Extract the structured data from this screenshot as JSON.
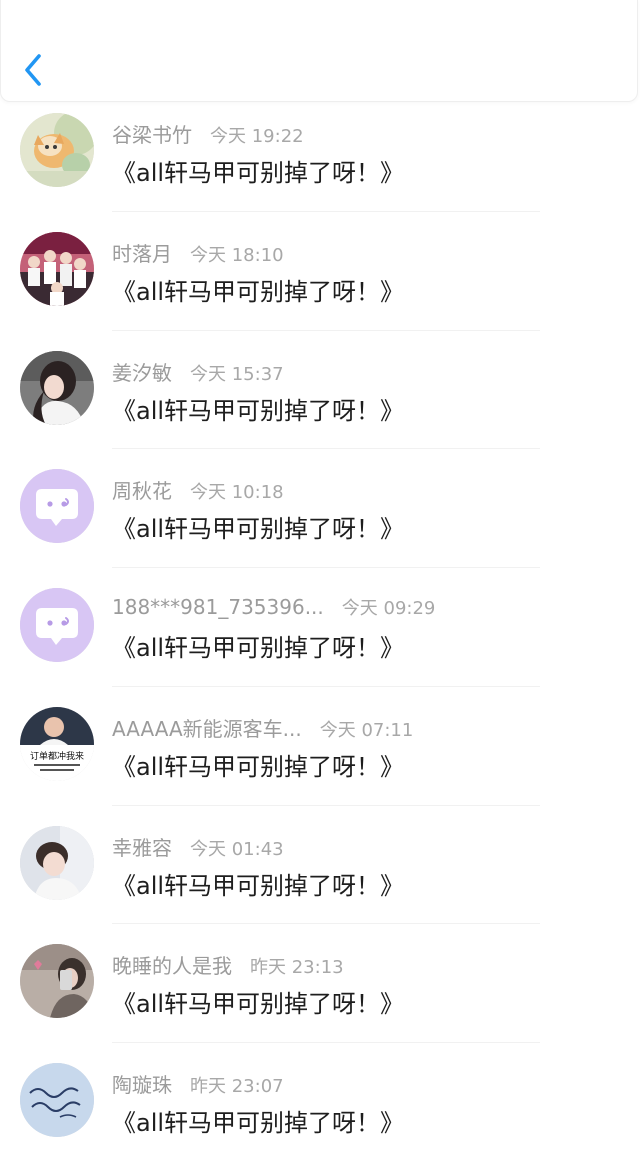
{
  "header": {
    "back_icon": "chevron-left-icon",
    "accent": "#2196f3"
  },
  "comments": [
    {
      "name": "谷梁书竹",
      "time": "今天 19:22",
      "text": "《all轩马甲可别掉了呀！》",
      "avatar": "kitten-photo"
    },
    {
      "name": "时落月",
      "time": "今天 18:10",
      "text": "《all轩马甲可别掉了呀！》",
      "avatar": "group-photo"
    },
    {
      "name": "姜汐敏",
      "time": "今天 15:37",
      "text": "《all轩马甲可别掉了呀！》",
      "avatar": "girl-photo"
    },
    {
      "name": "周秋花",
      "time": "今天 10:18",
      "text": "《all轩马甲可别掉了呀！》",
      "avatar": "default-chat-avatar"
    },
    {
      "name": "188***981_735396...",
      "time": "今天 09:29",
      "text": "《all轩马甲可别掉了呀！》",
      "avatar": "default-chat-avatar"
    },
    {
      "name": "AAAAA新能源客车...",
      "time": "今天 07:11",
      "text": "《all轩马甲可别掉了呀！》",
      "avatar": "ad-photo",
      "avatar_text": "订单都冲我来"
    },
    {
      "name": "幸雅容",
      "time": "今天 01:43",
      "text": "《all轩马甲可别掉了呀！》",
      "avatar": "boy-photo"
    },
    {
      "name": "晚睡的人是我",
      "time": "昨天 23:13",
      "text": "《all轩马甲可别掉了呀！》",
      "avatar": "selfie-photo"
    },
    {
      "name": "陶璇珠",
      "time": "昨天 23:07",
      "text": "《all轩马甲可别掉了呀！》",
      "avatar": "handwriting-photo"
    }
  ]
}
